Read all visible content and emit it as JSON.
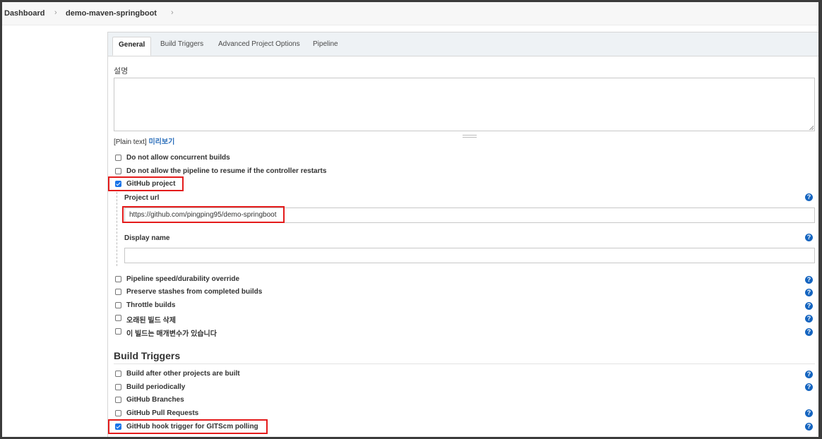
{
  "breadcrumb": {
    "items": [
      "Dashboard",
      "demo-maven-springboot"
    ],
    "separator": "›"
  },
  "tabs": [
    {
      "label": "General",
      "active": true
    },
    {
      "label": "Build Triggers",
      "active": false
    },
    {
      "label": "Advanced Project Options",
      "active": false
    },
    {
      "label": "Pipeline",
      "active": false
    }
  ],
  "general": {
    "description_label": "설명",
    "description_value": "",
    "plain_text": "[Plain text]",
    "preview_link": "미리보기",
    "options": [
      {
        "label": "Do not allow concurrent builds",
        "checked": false,
        "help": false
      },
      {
        "label": "Do not allow the pipeline to resume if the controller restarts",
        "checked": false,
        "help": false
      },
      {
        "label": "GitHub project",
        "checked": true,
        "help": false
      }
    ],
    "github": {
      "project_url_label": "Project url",
      "project_url_value": "https://github.com/pingping95/demo-springboot",
      "display_name_label": "Display name",
      "display_name_value": ""
    },
    "more_options": [
      {
        "label": "Pipeline speed/durability override",
        "checked": false,
        "help": true
      },
      {
        "label": "Preserve stashes from completed builds",
        "checked": false,
        "help": true
      },
      {
        "label": "Throttle builds",
        "checked": false,
        "help": true
      },
      {
        "label": "오래된 빌드 삭제",
        "checked": false,
        "help": true
      },
      {
        "label": "이 빌드는 매개변수가 있습니다",
        "checked": false,
        "help": true
      }
    ]
  },
  "build_triggers": {
    "title": "Build Triggers",
    "options": [
      {
        "label": "Build after other projects are built",
        "checked": false,
        "help": true
      },
      {
        "label": "Build periodically",
        "checked": false,
        "help": true
      },
      {
        "label": "GitHub Branches",
        "checked": false,
        "help": false
      },
      {
        "label": "GitHub Pull Requests",
        "checked": false,
        "help": true
      },
      {
        "label": "GitHub hook trigger for GITScm polling",
        "checked": true,
        "help": true
      }
    ]
  },
  "help_icon_glyph": "?",
  "colors": {
    "accent": "#1a73e8",
    "help_icon": "#1565c0",
    "highlight": "#e41b1b",
    "link": "#2a6ebb"
  }
}
